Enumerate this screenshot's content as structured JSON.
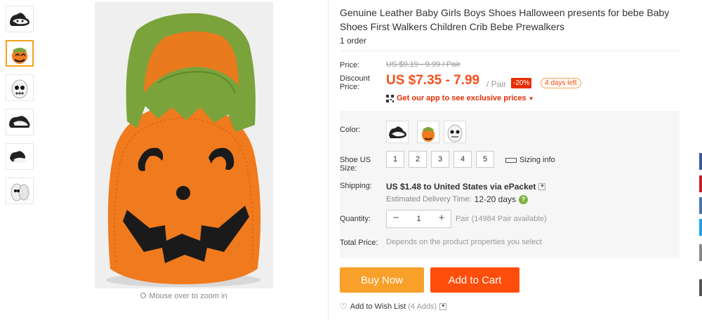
{
  "gallery": {
    "thumbnails": [
      "black-white-shoe",
      "pumpkin-shoe",
      "skull-shoe",
      "black-white-shoe-side",
      "black-white-shoe-pair",
      "skull-shoe-pair"
    ],
    "active_index": 1,
    "zoom_hint": "Mouse over to zoom in"
  },
  "product": {
    "title": "Genuine Leather Baby Girls Boys Shoes Halloween presents for bebe Baby Shoes First Walkers Children Crib Bebe Prewalkers",
    "orders": "1 order"
  },
  "price": {
    "price_label": "Price:",
    "original": "US $9.19 - 9.99 / Pair",
    "discount_label_1": "Discount",
    "discount_label_2": "Price:",
    "discounted": "US $7.35 - 7.99",
    "unit": "/ Pair",
    "off_badge": "-20%",
    "days_left": "4 days left",
    "app_promo": "Get our app to see exclusive prices"
  },
  "options": {
    "color_label": "Color:",
    "colors": [
      "black-white",
      "pumpkin",
      "skull"
    ],
    "size_label_1": "Shoe US",
    "size_label_2": "Size:",
    "sizes": [
      "1",
      "2",
      "3",
      "4",
      "5"
    ],
    "sizing_info": "Sizing info"
  },
  "shipping": {
    "label": "Shipping:",
    "value": "US $1.48 to United States via ePacket",
    "delivery_label": "Estimated Delivery Time:",
    "delivery_days": "12-20 days"
  },
  "quantity": {
    "label": "Quantity:",
    "minus": "−",
    "value": "1",
    "plus": "+",
    "available": "Pair (14984 Pair available)"
  },
  "total": {
    "label": "Total Price:",
    "hint": "Depends on the product properties you select"
  },
  "actions": {
    "buy_now": "Buy Now",
    "add_to_cart": "Add to Cart",
    "wishlist": "Add to Wish List",
    "wishlist_count": "(4 Adds)"
  },
  "colors": {
    "accent_orange": "#f4511e",
    "buy_button": "#f9a02b",
    "cart_button": "#ff4d0b",
    "badge_red": "#e62e04",
    "delivery_help": "#7cb342"
  },
  "share_tabs": [
    "#3b5998",
    "#cb2027",
    "#4a76a8",
    "#1da1f2",
    "#888888",
    "#555555"
  ]
}
